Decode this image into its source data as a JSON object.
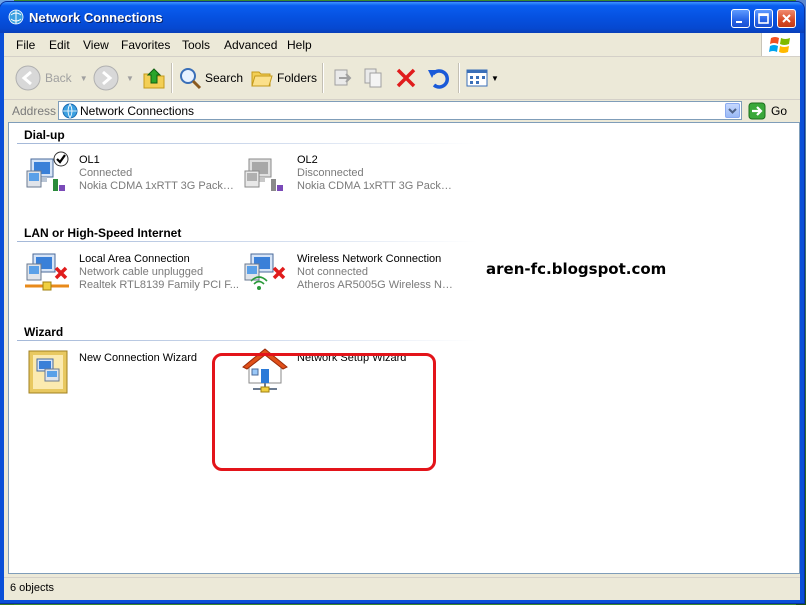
{
  "window": {
    "title": "Network Connections"
  },
  "menu": [
    "File",
    "Edit",
    "View",
    "Favorites",
    "Tools",
    "Advanced",
    "Help"
  ],
  "toolbar": {
    "back_label": "Back",
    "search_label": "Search",
    "folders_label": "Folders"
  },
  "address": {
    "label": "Address",
    "value": "Network Connections",
    "go_label": "Go"
  },
  "groups": [
    {
      "title": "Dial-up",
      "items": [
        {
          "name": "OL1",
          "status": "Connected",
          "device": "Nokia CDMA 1xRTT 3G Packet ...",
          "icon": "dialup-connected-icon"
        },
        {
          "name": "OL2",
          "status": "Disconnected",
          "device": "Nokia CDMA 1xRTT 3G Packet ...",
          "icon": "dialup-disconnected-icon"
        }
      ]
    },
    {
      "title": "LAN or High-Speed Internet",
      "items": [
        {
          "name": "Local Area Connection",
          "status": "Network cable unplugged",
          "device": "Realtek RTL8139 Family PCI F...",
          "icon": "lan-unplugged-icon"
        },
        {
          "name": "Wireless Network Connection",
          "status": "Not connected",
          "device": "Atheros AR5005G Wireless Ne...",
          "icon": "wireless-not-connected-icon"
        }
      ]
    },
    {
      "title": "Wizard",
      "items": [
        {
          "name": "New Connection Wizard",
          "icon": "new-connection-wizard-icon"
        },
        {
          "name": "Network Setup Wizard",
          "icon": "network-setup-wizard-icon"
        }
      ]
    }
  ],
  "watermark": "aren-fc.blogspot.com",
  "status": {
    "text": "6 objects"
  },
  "colors": {
    "highlight": "#e3141a",
    "titlebar": "#0651e0",
    "window_bg": "#ece9d8"
  }
}
